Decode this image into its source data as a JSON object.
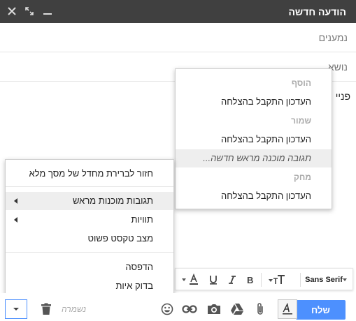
{
  "window": {
    "title": "הודעה חדשה"
  },
  "fields": {
    "to_placeholder": "נמענים",
    "subject_placeholder": "נושא"
  },
  "body": {
    "text": "פניי"
  },
  "templates_menu": {
    "sections": [
      {
        "header": "הוסף",
        "item": "העדכון התקבל בהצלחה"
      },
      {
        "header": "שמור",
        "item": "העדכון התקבל בהצלחה",
        "extra_item": "תגובה מוכנה מראש חדשה..."
      },
      {
        "header": "מחק",
        "item": "העדכון התקבל בהצלחה"
      }
    ]
  },
  "more_menu": {
    "fullscreen": "חזור לברירת מחדל של מסך מלא",
    "canned": "תגובות מוכנות מראש",
    "labels": "תוויות",
    "plain_text": "מצב טקסט פשוט",
    "print": "הדפסה",
    "spellcheck": "בדוק איות"
  },
  "format_bar": {
    "font": "Sans Serif"
  },
  "bottom_bar": {
    "send_label": "שלח",
    "saved_label": "נשמרה"
  },
  "colors": {
    "titlebar": "#404040",
    "send": "#4d90fe",
    "highlight": "#eeeeee"
  }
}
